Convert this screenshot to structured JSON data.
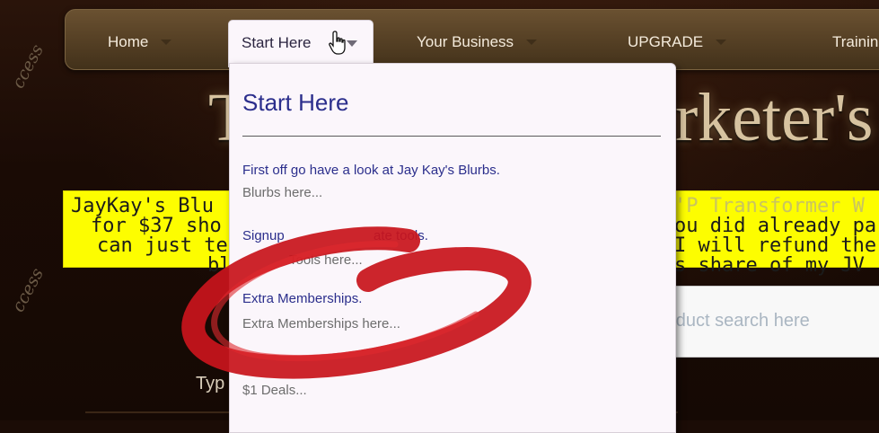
{
  "watermark": "ccess",
  "nav": {
    "home": "Home",
    "start_here": "Start Here",
    "your_business": "Your Business",
    "upgrade": "UPGRADE",
    "training": "Training"
  },
  "title": {
    "left_part": "T",
    "right_part": "rketer's"
  },
  "banner": {
    "left_lines": [
      "JayKay's Blu",
      "for $37 sho",
      "can just tel",
      "bl"
    ],
    "right_lines": [
      "'P Transformer W",
      "ou did already pa",
      " I will refund the",
      "s share of my JV"
    ]
  },
  "search": {
    "placeholder": "roduct search here"
  },
  "type_label": "Typ",
  "dropdown": {
    "heading": "Start Here",
    "items": [
      {
        "link": "First off go have a look at Jay Kay's Blurbs.",
        "sub": "Blurbs here..."
      },
      {
        "link": "Signup",
        "link_tail": "ate tools.",
        "sub": "Tools here..."
      },
      {
        "link": "Extra Memberships.",
        "sub": "Extra Memberships here..."
      },
      {
        "link": "$1 Deals..."
      }
    ]
  },
  "colors": {
    "nav_bg": "#584226",
    "dropdown_bg": "#fbf6fb",
    "link": "#2b2e8c",
    "banner": "#fdfd00",
    "annotation": "#c8141c"
  }
}
